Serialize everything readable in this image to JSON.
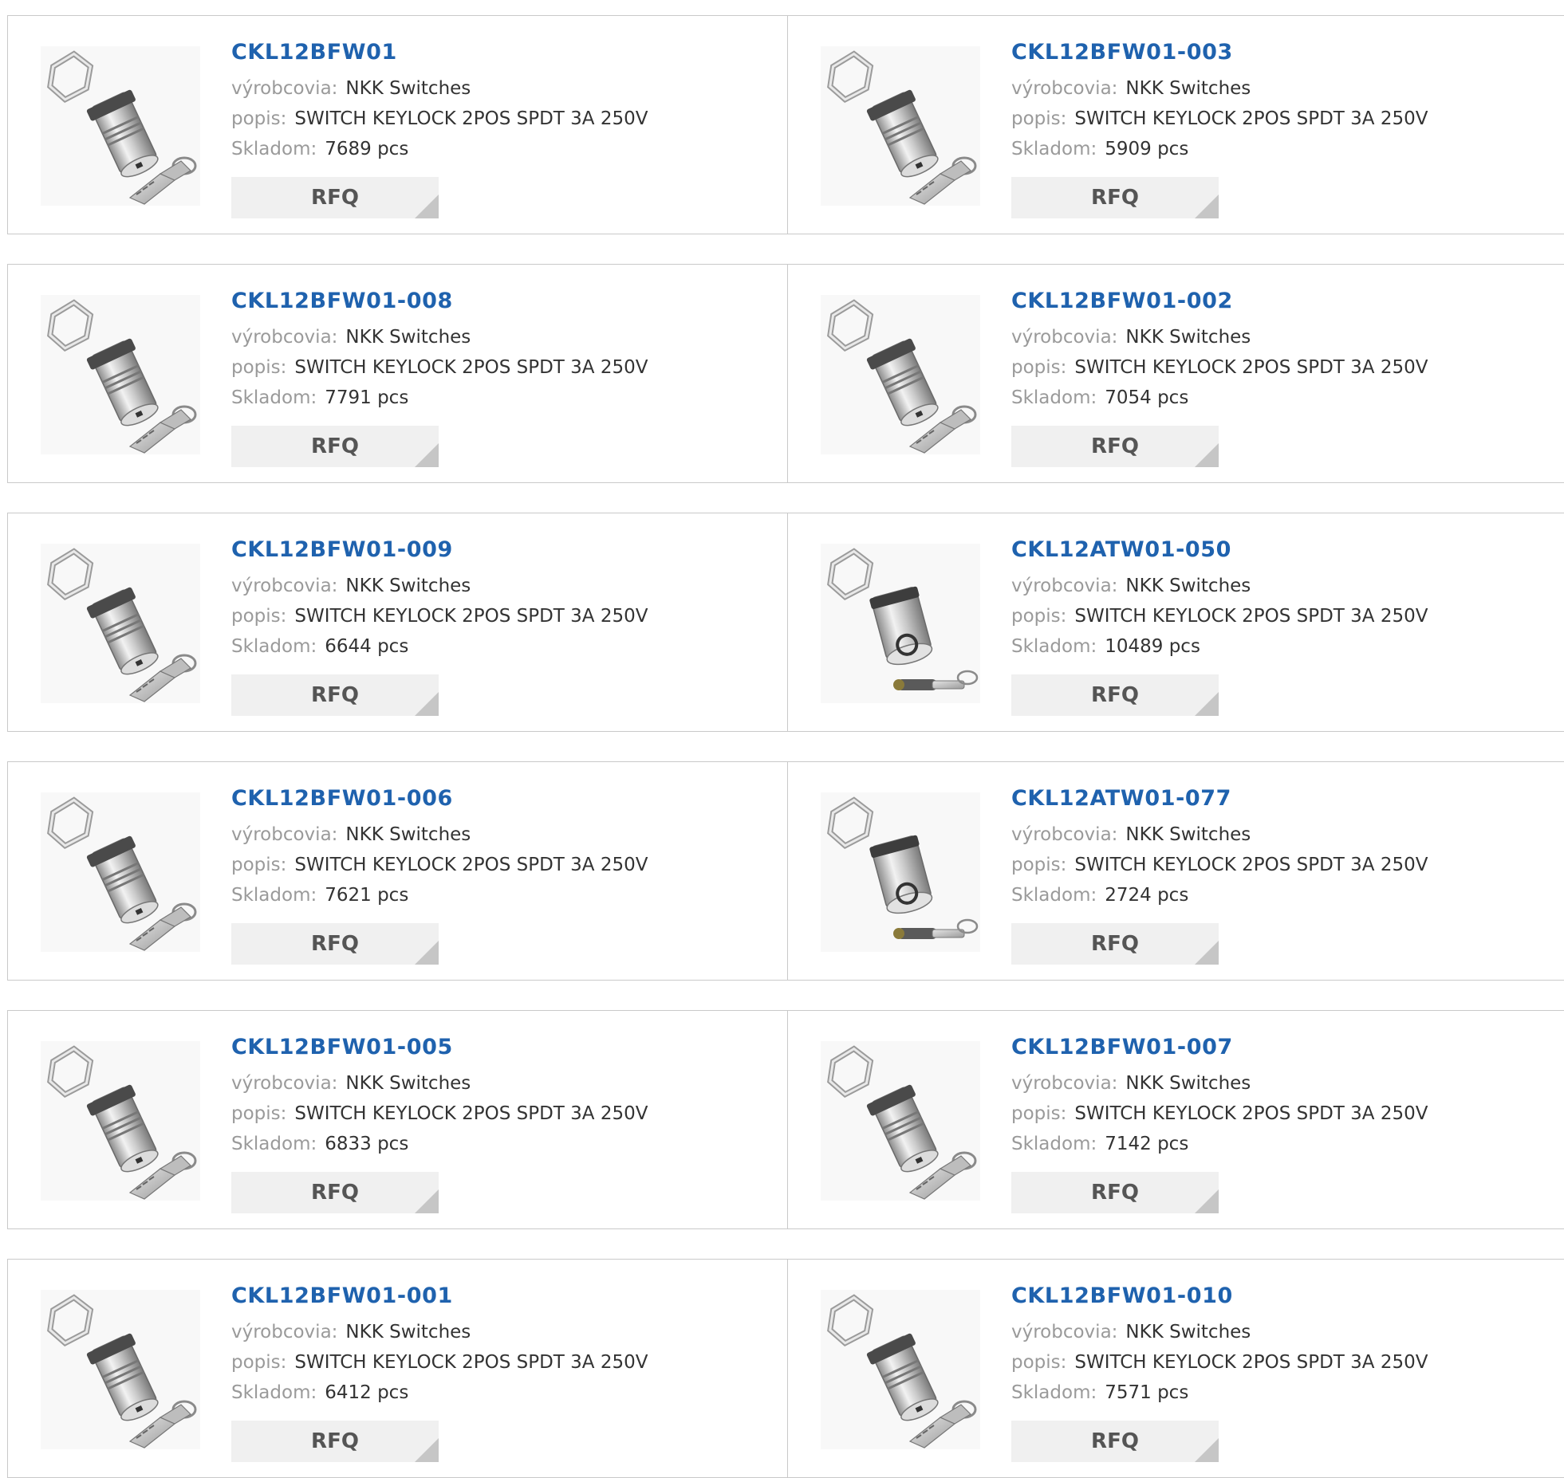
{
  "labels": {
    "manufacturer": "výrobcovia:",
    "description": "popis:",
    "stock": "Skladom:",
    "rfq": "RFQ"
  },
  "colors": {
    "part_number": "#1f62ae",
    "label": "#9a9a9a",
    "value": "#333333",
    "rfq_bg": "#f0f0f0"
  },
  "products": [
    {
      "part": "CKL12BFW01",
      "manufacturer": "NKK Switches",
      "description": "SWITCH KEYLOCK 2POS SPDT 3A 250V",
      "stock": "7689 pcs",
      "image": "keylock-switch-flat-key"
    },
    {
      "part": "CKL12BFW01-003",
      "manufacturer": "NKK Switches",
      "description": "SWITCH KEYLOCK 2POS SPDT 3A 250V",
      "stock": "5909 pcs",
      "image": "keylock-switch-flat-key"
    },
    {
      "part": "CKL12BFW01-008",
      "manufacturer": "NKK Switches",
      "description": "SWITCH KEYLOCK 2POS SPDT 3A 250V",
      "stock": "7791 pcs",
      "image": "keylock-switch-flat-key"
    },
    {
      "part": "CKL12BFW01-002",
      "manufacturer": "NKK Switches",
      "description": "SWITCH KEYLOCK 2POS SPDT 3A 250V",
      "stock": "7054 pcs",
      "image": "keylock-switch-flat-key"
    },
    {
      "part": "CKL12BFW01-009",
      "manufacturer": "NKK Switches",
      "description": "SWITCH KEYLOCK 2POS SPDT 3A 250V",
      "stock": "6644 pcs",
      "image": "keylock-switch-flat-key"
    },
    {
      "part": "CKL12ATW01-050",
      "manufacturer": "NKK Switches",
      "description": "SWITCH KEYLOCK 2POS SPDT 3A 250V",
      "stock": "10489 pcs",
      "image": "keylock-switch-tubular-key"
    },
    {
      "part": "CKL12BFW01-006",
      "manufacturer": "NKK Switches",
      "description": "SWITCH KEYLOCK 2POS SPDT 3A 250V",
      "stock": "7621 pcs",
      "image": "keylock-switch-flat-key"
    },
    {
      "part": "CKL12ATW01-077",
      "manufacturer": "NKK Switches",
      "description": "SWITCH KEYLOCK 2POS SPDT 3A 250V",
      "stock": "2724 pcs",
      "image": "keylock-switch-tubular-key"
    },
    {
      "part": "CKL12BFW01-005",
      "manufacturer": "NKK Switches",
      "description": "SWITCH KEYLOCK 2POS SPDT 3A 250V",
      "stock": "6833 pcs",
      "image": "keylock-switch-flat-key"
    },
    {
      "part": "CKL12BFW01-007",
      "manufacturer": "NKK Switches",
      "description": "SWITCH KEYLOCK 2POS SPDT 3A 250V",
      "stock": "7142 pcs",
      "image": "keylock-switch-flat-key"
    },
    {
      "part": "CKL12BFW01-001",
      "manufacturer": "NKK Switches",
      "description": "SWITCH KEYLOCK 2POS SPDT 3A 250V",
      "stock": "6412 pcs",
      "image": "keylock-switch-flat-key"
    },
    {
      "part": "CKL12BFW01-010",
      "manufacturer": "NKK Switches",
      "description": "SWITCH KEYLOCK 2POS SPDT 3A 250V",
      "stock": "7571 pcs",
      "image": "keylock-switch-flat-key"
    }
  ]
}
